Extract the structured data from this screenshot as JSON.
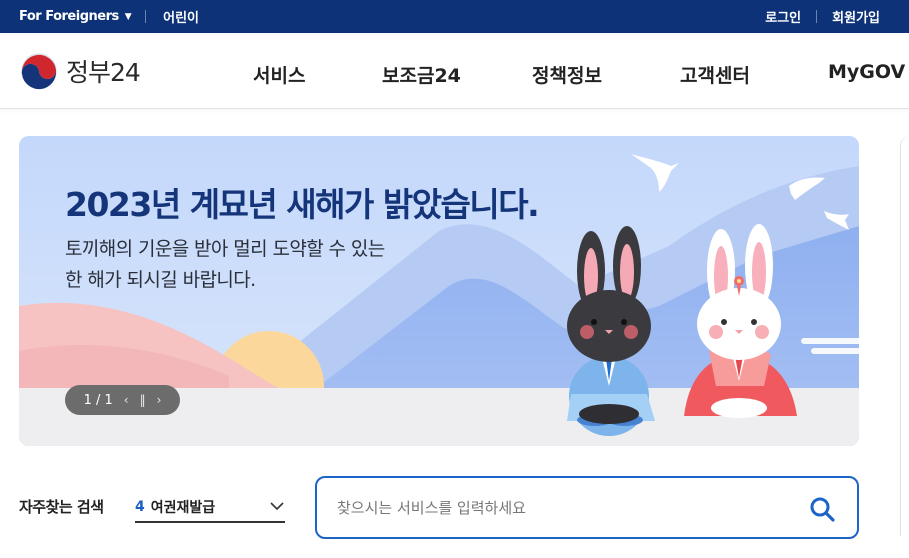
{
  "utility_bar": {
    "foreigners_label": "For Foreigners",
    "kids_label": "어린이",
    "login_label": "로그인",
    "signup_label": "회원가입"
  },
  "header": {
    "logo_text": "정부24",
    "nav": [
      {
        "label": "서비스"
      },
      {
        "label": "보조금24"
      },
      {
        "label": "정책정보"
      },
      {
        "label": "고객센터"
      },
      {
        "label": "MyGOV"
      }
    ]
  },
  "banner": {
    "title": "2023년 계묘년 새해가 밝았습니다.",
    "subtitle_line1": "토끼해의 기운을 받아 멀리 도약할 수 있는",
    "subtitle_line2": "한 해가 되시길 바랍니다.",
    "pager_text": "1 / 1"
  },
  "search": {
    "frequent_label": "자주찾는 검색",
    "keyword_rank": "4",
    "keyword_text": "여권재발급",
    "placeholder": "찾으시는 서비스를 입력하세요"
  },
  "colors": {
    "utility_bar_bg": "#0d3278",
    "accent_blue": "#1d64c8",
    "banner_title": "#14357a"
  }
}
